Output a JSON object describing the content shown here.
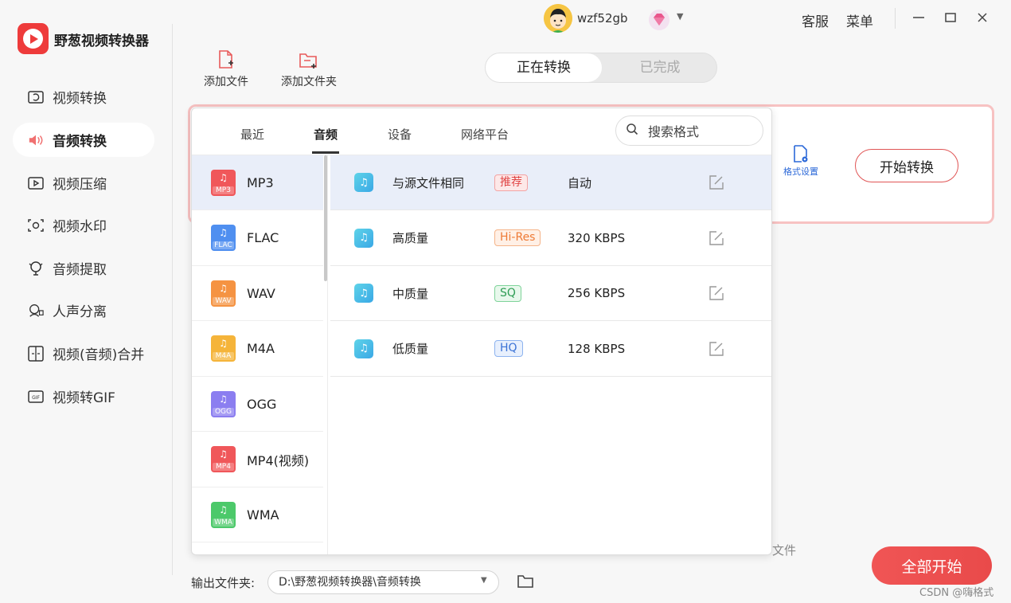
{
  "app": {
    "title": "野葱视频转换器"
  },
  "sidebar": {
    "items": [
      {
        "label": "视频转换",
        "icon": "video-convert-icon"
      },
      {
        "label": "音频转换",
        "icon": "audio-convert-icon"
      },
      {
        "label": "视频压缩",
        "icon": "video-compress-icon"
      },
      {
        "label": "视频水印",
        "icon": "watermark-icon"
      },
      {
        "label": "音频提取",
        "icon": "audio-extract-icon"
      },
      {
        "label": "人声分离",
        "icon": "vocal-separation-icon"
      },
      {
        "label": "视频(音频)合并",
        "icon": "merge-icon"
      },
      {
        "label": "视频转GIF",
        "icon": "gif-icon"
      }
    ],
    "active": "音频转换"
  },
  "topbar": {
    "username": "wzf52gb",
    "service": "客服",
    "menu": "菜单"
  },
  "toolbar": {
    "add_file": "添加文件",
    "add_folder": "添加文件夹"
  },
  "segment": {
    "converting": "正在转换",
    "completed": "已完成"
  },
  "card": {
    "format_settings": "格式设置",
    "start_convert": "开始转换"
  },
  "popup": {
    "tabs": [
      "最近",
      "音频",
      "设备",
      "网络平台"
    ],
    "active_tab": "音频",
    "search_placeholder": "搜索格式",
    "formats": [
      {
        "name": "MP3",
        "tag": "MP3",
        "color": "#f0575a"
      },
      {
        "name": "FLAC",
        "tag": "FLAC",
        "color": "#4f8ff0"
      },
      {
        "name": "WAV",
        "tag": "WAV",
        "color": "#f59342"
      },
      {
        "name": "M4A",
        "tag": "M4A",
        "color": "#f5b43a"
      },
      {
        "name": "OGG",
        "tag": "OGG",
        "color": "#8b7ef0"
      },
      {
        "name": "MP4(视频)",
        "tag": "MP4",
        "color": "#f0575a"
      },
      {
        "name": "WMA",
        "tag": "WMA",
        "color": "#4cc96a"
      }
    ],
    "selected_format": "MP3",
    "qualities": [
      {
        "name": "与源文件相同",
        "badge": "推荐",
        "badge_style": "red",
        "rate": "自动"
      },
      {
        "name": "高质量",
        "badge": "Hi-Res",
        "badge_style": "orange",
        "rate": "320 KBPS"
      },
      {
        "name": "中质量",
        "badge": "SQ",
        "badge_style": "green",
        "rate": "256 KBPS"
      },
      {
        "name": "低质量",
        "badge": "HQ",
        "badge_style": "blue",
        "rate": "128 KBPS"
      }
    ]
  },
  "bottom": {
    "output_label": "输出文件夹:",
    "output_path": "D:\\野葱视频转换器\\音频转换",
    "partial_text": "文件",
    "start_all": "全部开始"
  },
  "watermark": "CSDN @嗨格式"
}
